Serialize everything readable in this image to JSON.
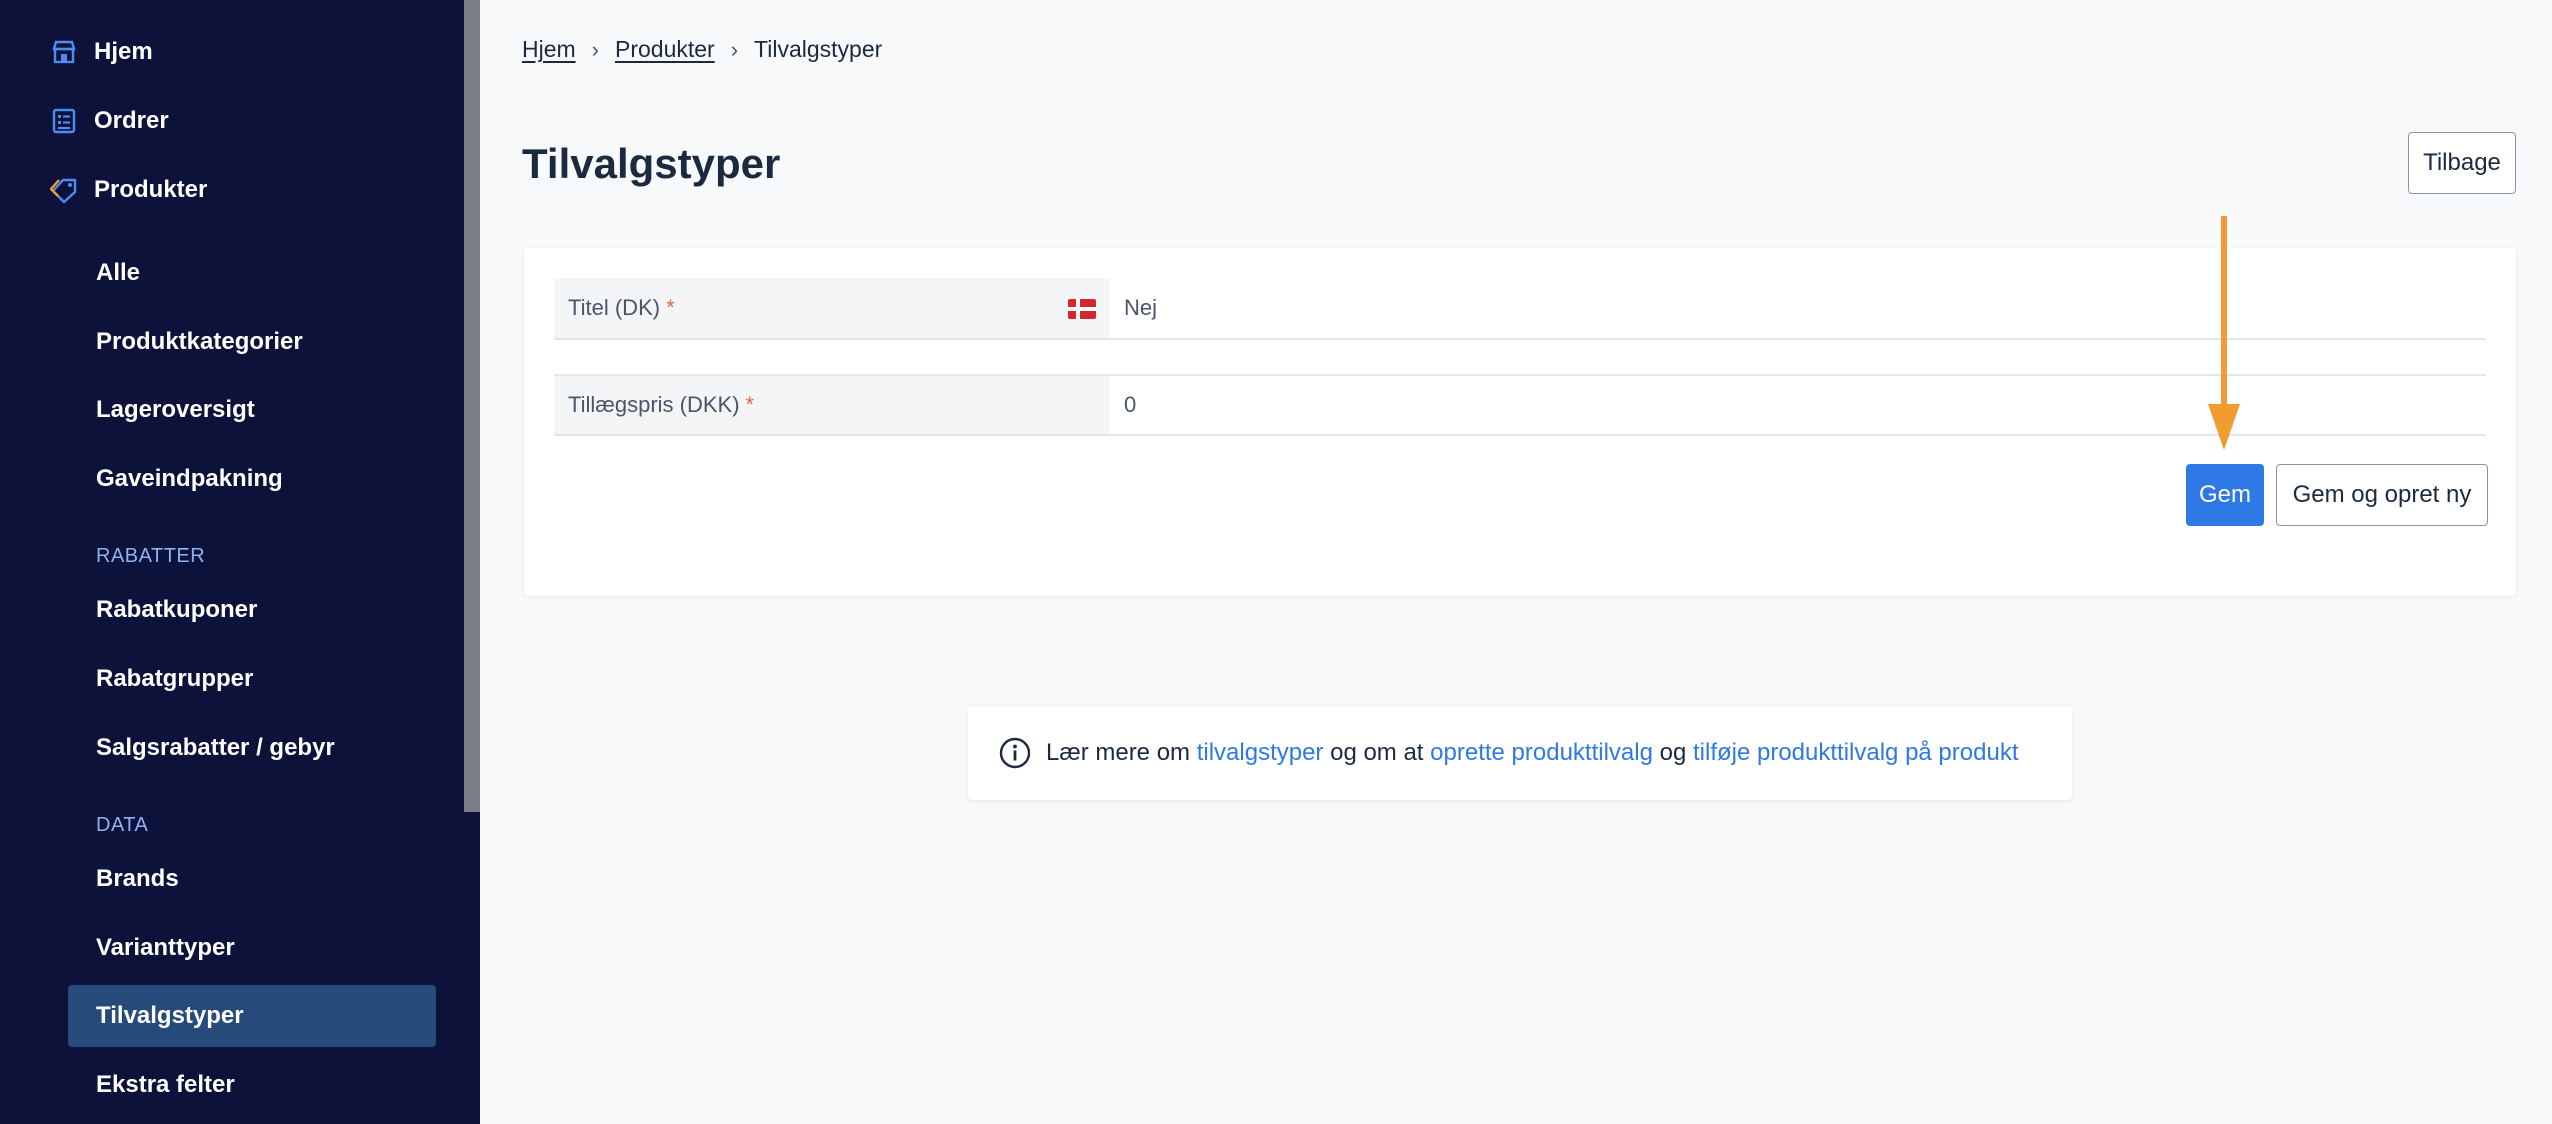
{
  "sidebar": {
    "top_items": [
      {
        "label": "Hjem",
        "icon": "shop-icon"
      },
      {
        "label": "Ordrer",
        "icon": "orders-icon"
      },
      {
        "label": "Produkter",
        "icon": "tag-icon"
      }
    ],
    "product_items": [
      "Alle",
      "Produktkategorier",
      "Lageroversigt",
      "Gaveindpakning"
    ],
    "section_rabatter": "RABATTER",
    "rabatter_items": [
      "Rabatkuponer",
      "Rabatgrupper",
      "Salgsrabatter / gebyr"
    ],
    "section_data": "DATA",
    "data_items": [
      "Brands",
      "Varianttyper",
      "Tilvalgstyper",
      "Ekstra felter"
    ],
    "active_item": "Tilvalgstyper",
    "colors": {
      "background": "#0c1239",
      "active": "#264a79",
      "section": "#8fb3f2"
    }
  },
  "breadcrumb": {
    "items": [
      "Hjem",
      "Produkter"
    ],
    "current": "Tilvalgstyper",
    "separator": "›"
  },
  "page": {
    "title": "Tilvalgstyper",
    "back_label": "Tilbage"
  },
  "form": {
    "fields": [
      {
        "label": "Titel (DK)",
        "required_mark": "*",
        "value": "Nej",
        "flag": "dk-flag-icon"
      },
      {
        "label": "Tillægspris (DKK)",
        "required_mark": "*",
        "value": "0"
      }
    ],
    "save_label": "Gem",
    "save_new_label": "Gem og opret ny"
  },
  "info": {
    "text_1": "Lær mere om ",
    "link_1": "tilvalgstyper",
    "text_2": " og om at ",
    "link_2": "oprette produkttilvalg",
    "text_3": " og ",
    "link_3": "tilføje produkttilvalg på produkt"
  },
  "colors": {
    "accent": "#2f79e6",
    "annotation_arrow": "#f29b30",
    "required": "#e1683a"
  }
}
